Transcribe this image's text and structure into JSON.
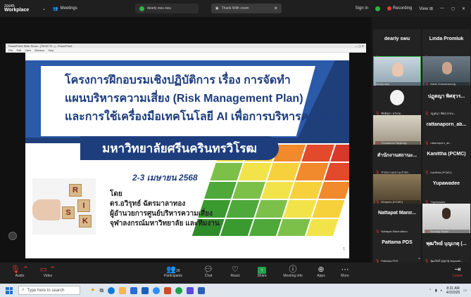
{
  "topbar": {
    "logo_brand": "zoom",
    "logo_product": "Workplace",
    "meetings_label": "Meetings",
    "tab1_label": "dearly swu swu",
    "tab2_label": "Thank With zoom",
    "signin_label": "Sign in",
    "recording_label": "Recording",
    "view_label": "View"
  },
  "shared_window": {
    "title": "PowerPoint Slide Show - [โครงการ...] - PowerPoint",
    "menu": [
      "File",
      "Edit",
      "View",
      "Window",
      "Help"
    ]
  },
  "slide": {
    "title_line1": "โครงการฝึกอบรมเชิงปฏิบัติการ เรื่อง การจัดทำ",
    "title_line2": "แผนบริหารความเสี่ยง (Risk Management Plan)",
    "title_line3": "และการใช้เครื่องมือเทคโนโลยี AI เพื่อการบริหารความเสี่ยง",
    "university": "มหาวิทยาลัยศรีนครินทรวิโรฒ",
    "date": "2-3 เมษายน 2568",
    "by_label": "โดย",
    "speaker_name": "ดร.อวิรุทธ์ ฉัตรมาลาทอง",
    "speaker_role": "ผู้อำนวยการศูนย์บริหารความเสี่ยง",
    "speaker_org": "จุฬาลงกรณ์มหาวิทยาลัย และทีมงาน",
    "dice_letters": [
      "R",
      "I",
      "S",
      "K"
    ],
    "page_number": "1"
  },
  "participants": [
    {
      "name": "dearly swu",
      "label": "dearly swu"
    },
    {
      "name": "Linda Promluk",
      "label": "Linda Promluk"
    },
    {
      "name": "",
      "label": "dearly swu"
    },
    {
      "name": "",
      "label": "Kanit Chomanerong"
    },
    {
      "name": "",
      "label": "ทิพย์สุดา หวังสม..."
    },
    {
      "name": "ปฏุตญา พิศสุวร...",
      "label": "ปฏุตญา พิศสุวรรณ..."
    },
    {
      "name": "",
      "label": "Chananorn Nuylung..."
    },
    {
      "name": "rattanaporn_ab...",
      "label": "rattanaporn_ab..."
    },
    {
      "name": "สำนักงานสถานะ...",
      "label": "สำนักงานสถานะสำนัก..."
    },
    {
      "name": "Kanittha (PCMC)",
      "label": "Kanittha (PCMC)"
    },
    {
      "name": "",
      "label": "Dhaporn (PCMC)"
    },
    {
      "name": "Yupawadee",
      "label": "Yupawadee"
    },
    {
      "name": "Nattapat Manir...",
      "label": "Nattapat Maniruttanu"
    },
    {
      "name": "",
      "label": "Surangi Swain"
    },
    {
      "name": "Pattama PDS",
      "label": "Pattama PDS"
    },
    {
      "name": "พุฒวิทย์ บุญเกตุ (...",
      "label": "พุฒวิทย์ บุญเกตุ Nayanth..."
    }
  ],
  "controls": {
    "audio": "Audio",
    "video": "Video",
    "participants": "Participants",
    "participants_count": "26",
    "chat": "Chat",
    "react": "React",
    "share": "Share",
    "meeting_info": "Meeting info",
    "apps": "Apps",
    "more": "More",
    "leave": "Leave"
  },
  "taskbar": {
    "search_placeholder": "Type here to search",
    "time": "8:31 AM",
    "date": "4/2/2025"
  },
  "colors": {
    "slide_navy": "#1d3d7d",
    "slide_blue": "#2a5aa8",
    "share_green": "#1fa34a",
    "mute_red": "#e03b3b"
  }
}
